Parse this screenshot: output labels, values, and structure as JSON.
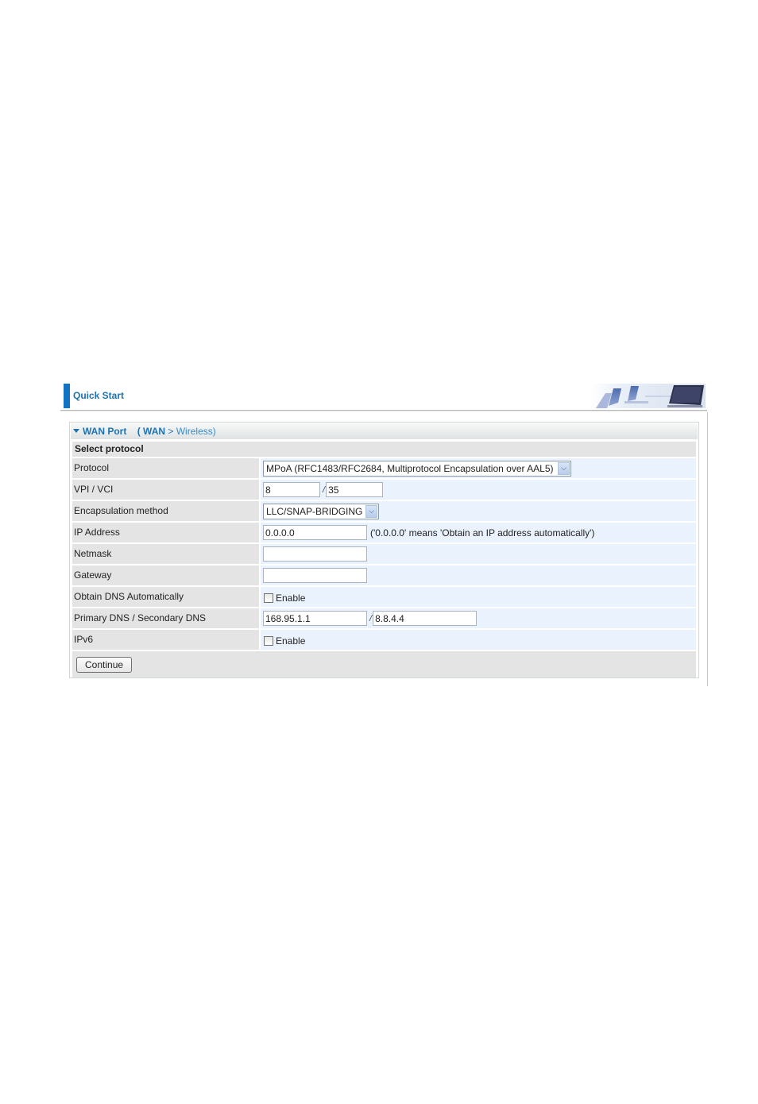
{
  "header": {
    "title": "Quick Start",
    "accent_color": "#1273c2"
  },
  "panel": {
    "title": "WAN Port",
    "breadcrumb": {
      "open": "(",
      "current": "WAN",
      "separator": ">",
      "next": "Wireless)"
    },
    "section": "Select protocol"
  },
  "form": {
    "protocol": {
      "label": "Protocol",
      "value": "MPoA (RFC1483/RFC2684, Multiprotocol Encapsulation over AAL5)"
    },
    "vpi_vci": {
      "label": "VPI / VCI",
      "vpi": "8",
      "separator": "/",
      "vci": "35"
    },
    "encapsulation": {
      "label": "Encapsulation method",
      "value": "LLC/SNAP-BRIDGING"
    },
    "ip_address": {
      "label": "IP Address",
      "value": "0.0.0.0",
      "hint": "('0.0.0.0' means 'Obtain an IP address automatically')"
    },
    "netmask": {
      "label": "Netmask",
      "value": ""
    },
    "gateway": {
      "label": "Gateway",
      "value": ""
    },
    "obtain_dns": {
      "label": "Obtain DNS Automatically",
      "checkbox_label": "Enable",
      "checked": false
    },
    "dns": {
      "label": "Primary DNS / Secondary DNS",
      "primary": "168.95.1.1",
      "separator": "/",
      "secondary": "8.8.4.4"
    },
    "ipv6": {
      "label": "IPv6",
      "checkbox_label": "Enable",
      "checked": false
    }
  },
  "buttons": {
    "continue": "Continue"
  },
  "icons": {
    "header_image": "office-chairs-monitor-banner",
    "collapse": "triangle-down-icon",
    "dropdown": "chevron-down-icon"
  }
}
